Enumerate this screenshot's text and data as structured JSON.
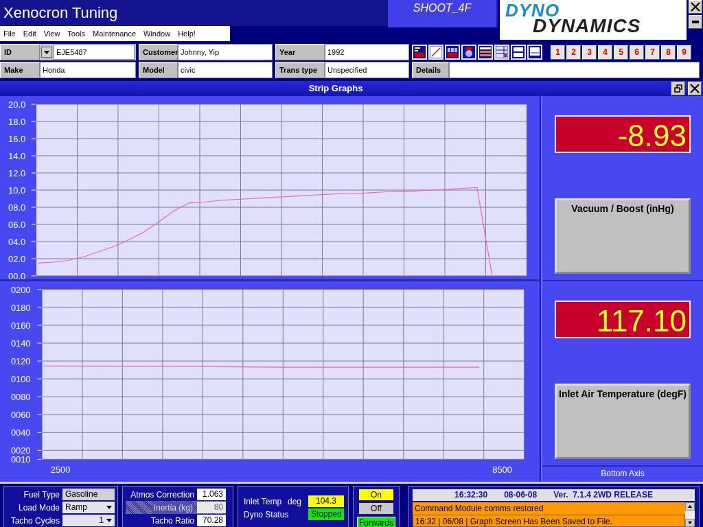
{
  "window": {
    "title": "Xenocron Tuning",
    "profile": "SHOOT_4F",
    "logo": {
      "line1": "DYNO",
      "line2": "DYNAMICS"
    }
  },
  "menu": [
    "File",
    "Edit",
    "View",
    "Tools",
    "Maintenance",
    "Window",
    "Help!"
  ],
  "vehicle": {
    "rows": [
      [
        {
          "label": "ID",
          "value": "EJE5487",
          "kind": "combo"
        },
        {
          "label": "Customer",
          "value": "Johnny, Yip",
          "kind": "text"
        },
        {
          "label": "Year",
          "value": "1992",
          "kind": "text"
        }
      ],
      [
        {
          "label": "Make",
          "value": "Honda",
          "kind": "text"
        },
        {
          "label": "Model",
          "value": "civic",
          "kind": "text"
        },
        {
          "label": "Trans type",
          "value": "Unspecified",
          "kind": "text"
        }
      ]
    ],
    "details": {
      "label": "Details"
    }
  },
  "presets": [
    "1",
    "2",
    "3",
    "4",
    "5",
    "6",
    "7",
    "8",
    "9"
  ],
  "strip_graphs": {
    "title": "Strip Graphs",
    "charts": [
      {
        "chart_data": {
          "type": "line",
          "categories": [
            null,
            null,
            null,
            null,
            null,
            null,
            null,
            null,
            null,
            null,
            null,
            null,
            null,
            null,
            null,
            null,
            null,
            null,
            null,
            null,
            null,
            null,
            null,
            null,
            null,
            null,
            null,
            null,
            null,
            null,
            null,
            null,
            null
          ],
          "series": [
            {
              "color": "#f060b0",
              "values": [
                1.5,
                1.6,
                1.8,
                2.2,
                2.8,
                3.4,
                4.2,
                5.1,
                6.3,
                7.6,
                8.5,
                8.6,
                8.8,
                8.9,
                9.0,
                9.1,
                9.2,
                9.3,
                9.4,
                9.5,
                9.6,
                9.6,
                9.7,
                9.8,
                9.8,
                9.9,
                10.0,
                10.1,
                10.2,
                10.3,
                0.0,
                null,
                null
              ]
            }
          ],
          "ylim": [
            0,
            20
          ],
          "grid": true,
          "yticks": [
            {
              "value": 0,
              "label": "00.0"
            },
            {
              "value": 2,
              "label": "02.0"
            },
            {
              "value": 4,
              "label": "04.0"
            },
            {
              "value": 6,
              "label": "06.0"
            },
            {
              "value": 8,
              "label": "08.0"
            },
            {
              "value": 10,
              "label": "10.0"
            },
            {
              "value": 12,
              "label": "12.0"
            },
            {
              "value": 14,
              "label": "14.0"
            },
            {
              "value": 16,
              "label": "16.0"
            },
            {
              "value": 18,
              "label": "18.0"
            },
            {
              "value": 20,
              "label": "20.0"
            }
          ]
        }
      },
      {
        "chart_data": {
          "type": "line",
          "x": [
            2271,
            4000,
            5500,
            7000,
            8185
          ],
          "series": [
            {
              "color": "#f060b0",
              "values": [
                114.4,
                114,
                113,
                113,
                113
              ]
            }
          ],
          "xlim": [
            2251,
            8795
          ],
          "ylim": [
            10,
            200
          ],
          "xticks": [
            2500,
            8500
          ],
          "grid": true,
          "yticks": [
            {
              "value": 10,
              "label": "0010"
            },
            {
              "value": 20,
              "label": "0020"
            },
            {
              "value": 40,
              "label": "0040"
            },
            {
              "value": 60,
              "label": "0060"
            },
            {
              "value": 80,
              "label": "0080"
            },
            {
              "value": 100,
              "label": "0100"
            },
            {
              "value": 120,
              "label": "0120"
            },
            {
              "value": 140,
              "label": "0140"
            },
            {
              "value": 160,
              "label": "0160"
            },
            {
              "value": 180,
              "label": "0180"
            },
            {
              "value": 200,
              "label": "0200"
            }
          ]
        }
      }
    ],
    "readouts": [
      {
        "value": "-8.93",
        "label": "Vacuum / Boost (inHg)"
      },
      {
        "value": "117.10",
        "label": "Inlet Air Temperature (degF)"
      }
    ],
    "bottom_axis": "Bottom Axis"
  },
  "settings": [
    {
      "label": "Fuel Type",
      "value": "Gasoline",
      "kind": "text"
    },
    {
      "label": "Load Mode",
      "value": "Ramp",
      "kind": "combo"
    },
    {
      "label": "Tacho Cycles",
      "value": "1",
      "kind": "combo"
    }
  ],
  "calibration": [
    {
      "label": "Atmos Correction",
      "value": "1.063",
      "disabled": false
    },
    {
      "label": "Inertia (kg)",
      "value": "80",
      "disabled": true
    },
    {
      "label": "Tacho Ratio",
      "value": "70.28",
      "disabled": false
    }
  ],
  "status": {
    "inlet_temp": {
      "label": "Inlet Temp",
      "unit": "deg",
      "value": "104.3"
    },
    "dyno_status": {
      "label": "Dyno Status",
      "value": "Stopped"
    }
  },
  "switches": [
    {
      "label": "On",
      "selected": true
    },
    {
      "label": "Off",
      "selected": false
    }
  ],
  "direction": "Forwards",
  "info": {
    "time": "16:32:30",
    "date": "08-06-08",
    "version": "Ver.  7.1.4 2WD RELEASE",
    "messages": [
      "Command Module comms restored",
      "16:32 | 06/08 | Graph Screen Has Been Saved to File."
    ]
  }
}
